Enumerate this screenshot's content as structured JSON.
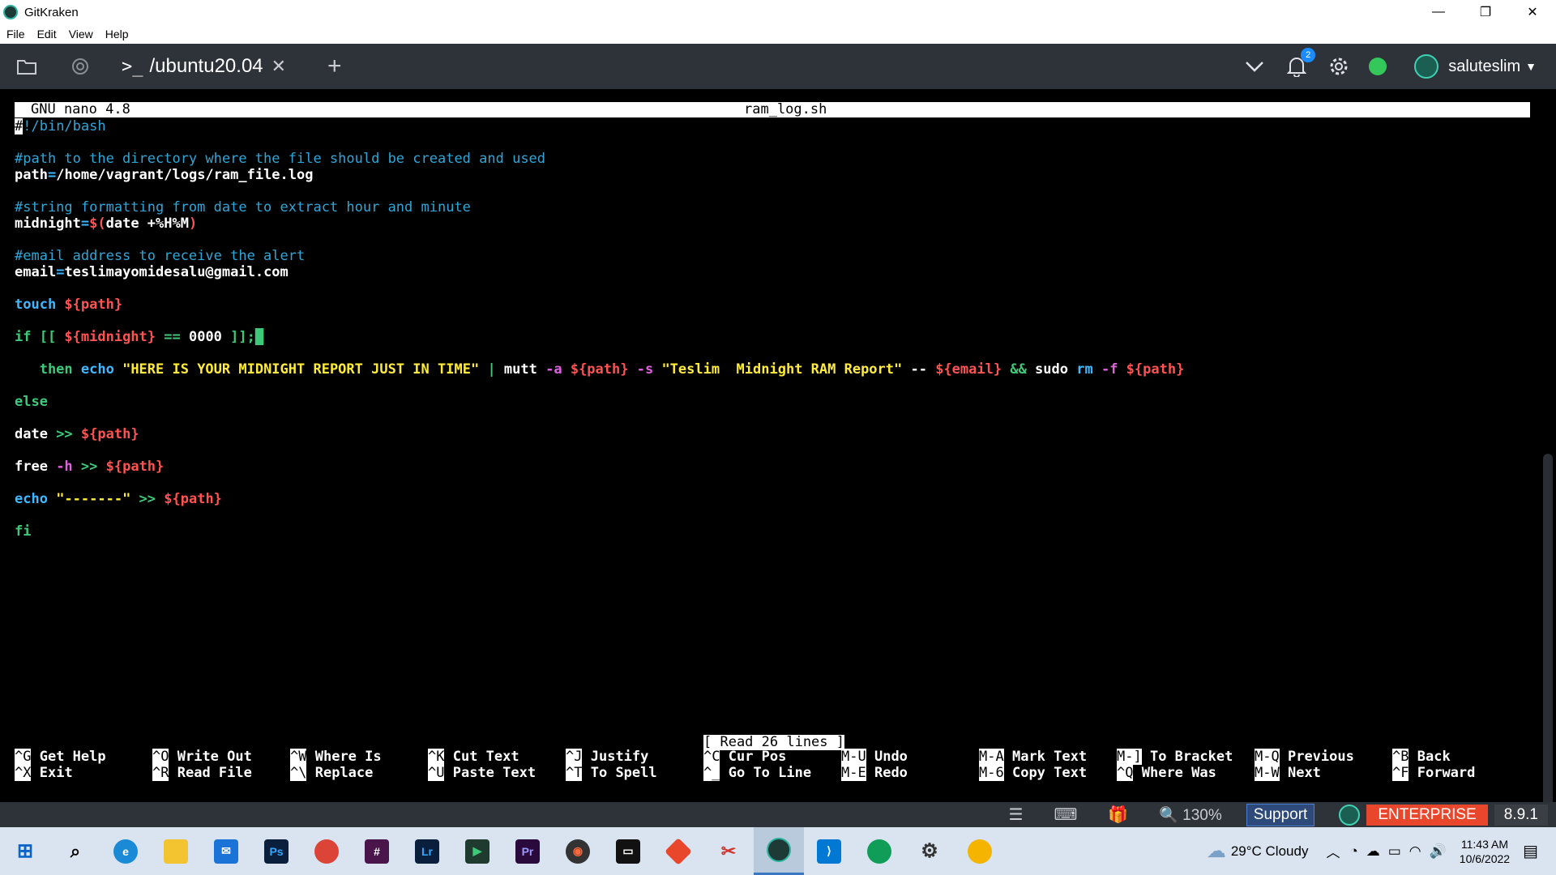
{
  "window": {
    "title": "GitKraken",
    "controls": [
      "—",
      "❐",
      "✕"
    ]
  },
  "menu": [
    "File",
    "Edit",
    "View",
    "Help"
  ],
  "toolbar": {
    "tab_prompt": ">_",
    "tab_title": "/ubuntu20.04",
    "tab_close": "✕",
    "add_tab": "+",
    "notification_count": "2",
    "username": "saluteslim"
  },
  "nano": {
    "version": "GNU nano 4.8",
    "filename": "ram_log.sh",
    "status_message": "[ Read 26 lines ]"
  },
  "code_lines": [
    "#!/bin/bash",
    "",
    "#path to the directory where the file should be created and used",
    "path=/home/vagrant/logs/ram_file.log",
    "",
    "#string formatting from date to extract hour and minute",
    "midnight=$(date +%H%M)",
    "",
    "#email address to receive the alert",
    "email=teslimayomidesalu@gmail.com",
    "",
    "touch ${path}",
    "",
    "if [[ ${midnight} == 0000 ]];",
    "",
    "   then echo \"HERE IS YOUR MIDNIGHT REPORT JUST IN TIME\" | mutt -a ${path} -s \"Teslim  Midnight RAM Report\" -- ${email} && sudo rm -f ${path}",
    "",
    "else",
    "",
    "date >> ${path}",
    "",
    "free -h >> ${path}",
    "",
    "echo \"-------\" >> ${path}",
    "",
    "fi"
  ],
  "shortcuts": [
    {
      "k1": "^G",
      "l1": "Get Help",
      "k2": "^X",
      "l2": "Exit"
    },
    {
      "k1": "^O",
      "l1": "Write Out",
      "k2": "^R",
      "l2": "Read File"
    },
    {
      "k1": "^W",
      "l1": "Where Is",
      "k2": "^\\",
      "l2": "Replace"
    },
    {
      "k1": "^K",
      "l1": "Cut Text",
      "k2": "^U",
      "l2": "Paste Text"
    },
    {
      "k1": "^J",
      "l1": "Justify",
      "k2": "^T",
      "l2": "To Spell"
    },
    {
      "k1": "^C",
      "l1": "Cur Pos",
      "k2": "^_",
      "l2": "Go To Line"
    },
    {
      "k1": "M-U",
      "l1": "Undo",
      "k2": "M-E",
      "l2": "Redo"
    },
    {
      "k1": "M-A",
      "l1": "Mark Text",
      "k2": "M-6",
      "l2": "Copy Text"
    },
    {
      "k1": "M-]",
      "l1": "To Bracket",
      "k2": "^Q",
      "l2": "Where Was"
    },
    {
      "k1": "M-Q",
      "l1": "Previous",
      "k2": "M-W",
      "l2": "Next"
    },
    {
      "k1": "^B",
      "l1": "Back",
      "k2": "^F",
      "l2": "Forward"
    }
  ],
  "footer": {
    "zoom": "130%",
    "support": "Support",
    "edition": "ENTERPRISE",
    "version": "8.9.1"
  },
  "taskbar": {
    "weather": "29°C  Cloudy",
    "time": "11:43 AM",
    "date": "10/6/2022"
  },
  "colors": {
    "toolbar_bg": "#2e3239",
    "comment": "#2fa6d8",
    "keyword": "#40b8ff",
    "variable": "#ff5252",
    "string": "#ffeb3b",
    "enterprise": "#e8472c"
  }
}
